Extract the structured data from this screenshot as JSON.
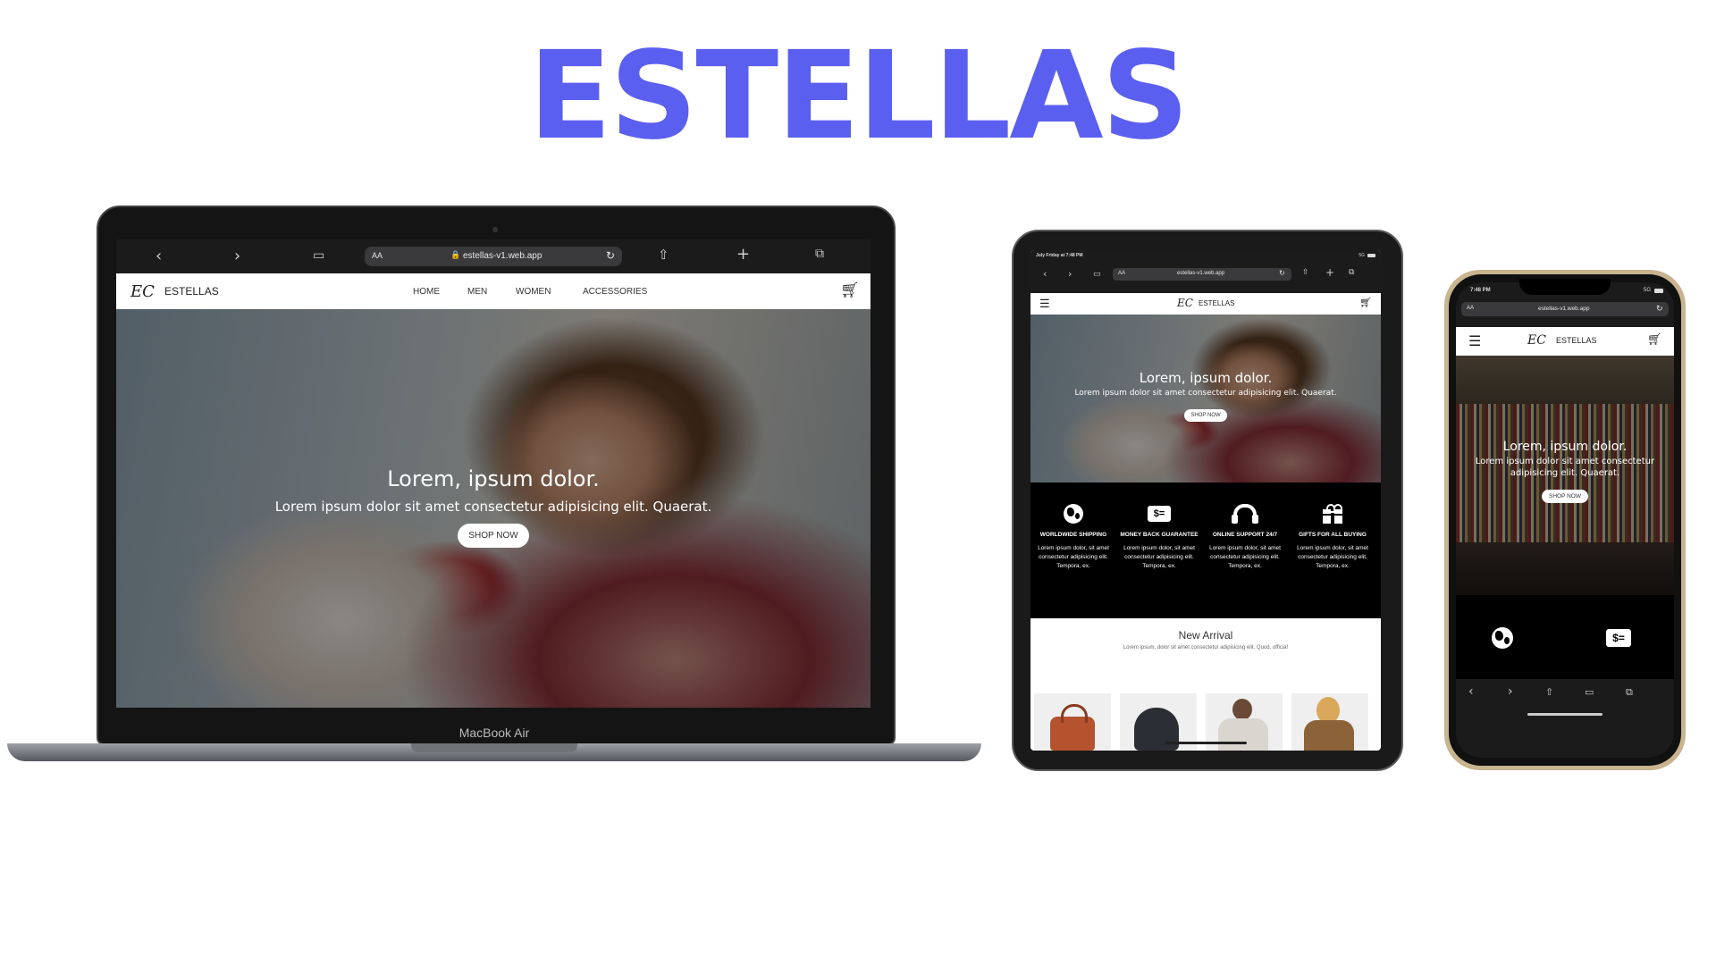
{
  "headline": "ESTELLAS",
  "colors": {
    "accent": "#5b5ff0",
    "site_dark": "#000000",
    "button_bg": "#ffffff"
  },
  "site": {
    "brand": "ESTELLAS",
    "logo_monogram": "EC",
    "url": "estellas-v1.web.app",
    "aa": "AA",
    "nav": [
      "HOME",
      "MEN",
      "WOMEN",
      "ACCESSORIES"
    ],
    "hero_title": "Lorem, ipsum dolor.",
    "hero_subtitle": "Lorem ipsum dolor sit amet consectetur adipisicing elit. Quaerat.",
    "shop_now": "SHOP NOW",
    "features": [
      {
        "icon": "globe-icon",
        "title": "WORLDWIDE SHIPPING",
        "desc": "Lorem ipsum dolor, sit amet consectetur adipisicing elit. Tempora, ex."
      },
      {
        "icon": "money-icon",
        "title": "MONEY BACK GUARANTEE",
        "desc": "Lorem ipsum dolor, sit amet consectetur adipisicing elit. Tempora, ex."
      },
      {
        "icon": "headset-icon",
        "title": "ONLINE SUPPORT 24/7",
        "desc": "Lorem ipsum dolor, sit amet consectetur adipisicing elit. Tempora, ex."
      },
      {
        "icon": "gift-icon",
        "title": "GIFTS FOR ALL BUYING",
        "desc": "Lorem ipsum dolor, sit amet consectetur adipisicing elit. Tempora, ex."
      }
    ],
    "new_arrival_title": "New Arrival",
    "new_arrival_desc": "Lorem ipsum, dolor sit amet consectetur adipisicing elit. Quod, officia!"
  },
  "laptop": {
    "label": "MacBook Air"
  },
  "tablet": {
    "status_time": "July Friday at 7:48 PM",
    "status_right": "5G"
  },
  "phone": {
    "status_time": "7:48 PM",
    "status_right": "5G"
  }
}
